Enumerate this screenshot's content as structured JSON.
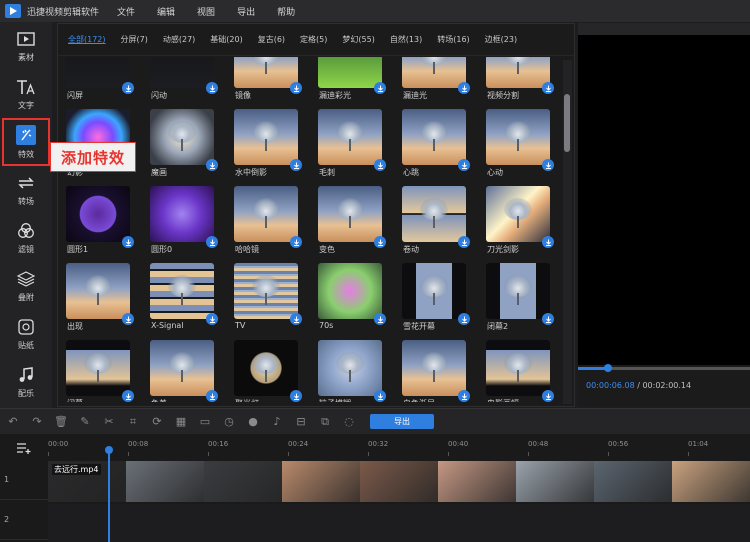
{
  "titlebar": {
    "app_title": "迅捷视频剪辑软件",
    "menus": [
      "文件",
      "编辑",
      "视图",
      "导出",
      "帮助"
    ]
  },
  "sidebar": {
    "items": [
      {
        "label": "素材",
        "icon": "film-icon"
      },
      {
        "label": "文字",
        "icon": "text-icon"
      },
      {
        "label": "特效",
        "icon": "effects-icon",
        "active": true
      },
      {
        "label": "转场",
        "icon": "transition-icon"
      },
      {
        "label": "滤镜",
        "icon": "filter-icon"
      },
      {
        "label": "叠附",
        "icon": "overlay-icon"
      },
      {
        "label": "贴纸",
        "icon": "sticker-icon"
      },
      {
        "label": "配乐",
        "icon": "music-icon"
      }
    ]
  },
  "annotation": {
    "text": "添加特效"
  },
  "filters": [
    {
      "label": "全部(172)",
      "active": true
    },
    {
      "label": "分屏(7)"
    },
    {
      "label": "动感(27)"
    },
    {
      "label": "基础(20)"
    },
    {
      "label": "复古(6)"
    },
    {
      "label": "定格(5)"
    },
    {
      "label": "梦幻(55)"
    },
    {
      "label": "自然(13)"
    },
    {
      "label": "转场(16)"
    },
    {
      "label": "边框(23)"
    }
  ],
  "effects": [
    {
      "label": "闪屏",
      "style": "dark"
    },
    {
      "label": "闪动",
      "style": "dark"
    },
    {
      "label": "镜像",
      "style": "sunset"
    },
    {
      "label": "漏迪彩光",
      "style": "green"
    },
    {
      "label": "漏迪光",
      "style": "sunset"
    },
    {
      "label": "视频分割",
      "style": "sunset"
    },
    {
      "label": "幻影",
      "style": "rainbow"
    },
    {
      "label": "魔画",
      "style": "zoom"
    },
    {
      "label": "水中倒影",
      "style": "sunset"
    },
    {
      "label": "毛刺",
      "style": "sunset"
    },
    {
      "label": "心跳",
      "style": "sunset"
    },
    {
      "label": "心动",
      "style": "sunset"
    },
    {
      "label": "圆形1",
      "style": "purple-circle"
    },
    {
      "label": "圆形0",
      "style": "purple"
    },
    {
      "label": "哈哈镜",
      "style": "sunset"
    },
    {
      "label": "变色",
      "style": "sunset"
    },
    {
      "label": "卷动",
      "style": "split"
    },
    {
      "label": "刀光剑影",
      "style": "flare"
    },
    {
      "label": "出现",
      "style": "sunset"
    },
    {
      "label": "X-Signal",
      "style": "glitch"
    },
    {
      "label": "TV",
      "style": "tv"
    },
    {
      "label": "70s",
      "style": "seventies"
    },
    {
      "label": "雪花开幕",
      "style": "narrow"
    },
    {
      "label": "闭幕2",
      "style": "narrow"
    },
    {
      "label": "闭幕",
      "style": "letterbox"
    },
    {
      "label": "色差",
      "style": "sunset"
    },
    {
      "label": "聚光灯",
      "style": "spotlight"
    },
    {
      "label": "粒子模糊",
      "style": "particles"
    },
    {
      "label": "白色渐显",
      "style": "sunset"
    },
    {
      "label": "电影画幅",
      "style": "letterbox"
    }
  ],
  "preview": {
    "current_time": "00:00:06.08",
    "separator": " / ",
    "total_time": "00:02:00.14",
    "progress": 0.17
  },
  "toolbar": {
    "icons": [
      "undo-icon",
      "redo-icon",
      "delete-icon",
      "edit-icon",
      "cut-icon",
      "crop-icon",
      "rotate-icon",
      "mosaic-icon",
      "freeze-icon",
      "speed-icon",
      "record-icon",
      "voice-icon",
      "split-icon",
      "copy-icon",
      "mask-icon"
    ],
    "export_label": "导出"
  },
  "timeline": {
    "ruler": [
      "00:00",
      "00:08",
      "00:16",
      "00:24",
      "00:32",
      "00:40",
      "00:48",
      "00:56",
      "01:04"
    ],
    "tracks": [
      {
        "label": "1"
      },
      {
        "label": "2"
      }
    ],
    "clip_name": "去远行.mp4",
    "frames": [
      "#2a2a2c",
      "#6a7078",
      "#3a3c40",
      "#b98a6c",
      "#7b5a4a",
      "#c59884",
      "#9aa2ac",
      "#5b6570",
      "#c9a27f",
      "#e8e8e8"
    ],
    "playhead_seconds": 6.08
  },
  "colors": {
    "accent": "#2f7fe0",
    "highlight": "#e8342f"
  }
}
